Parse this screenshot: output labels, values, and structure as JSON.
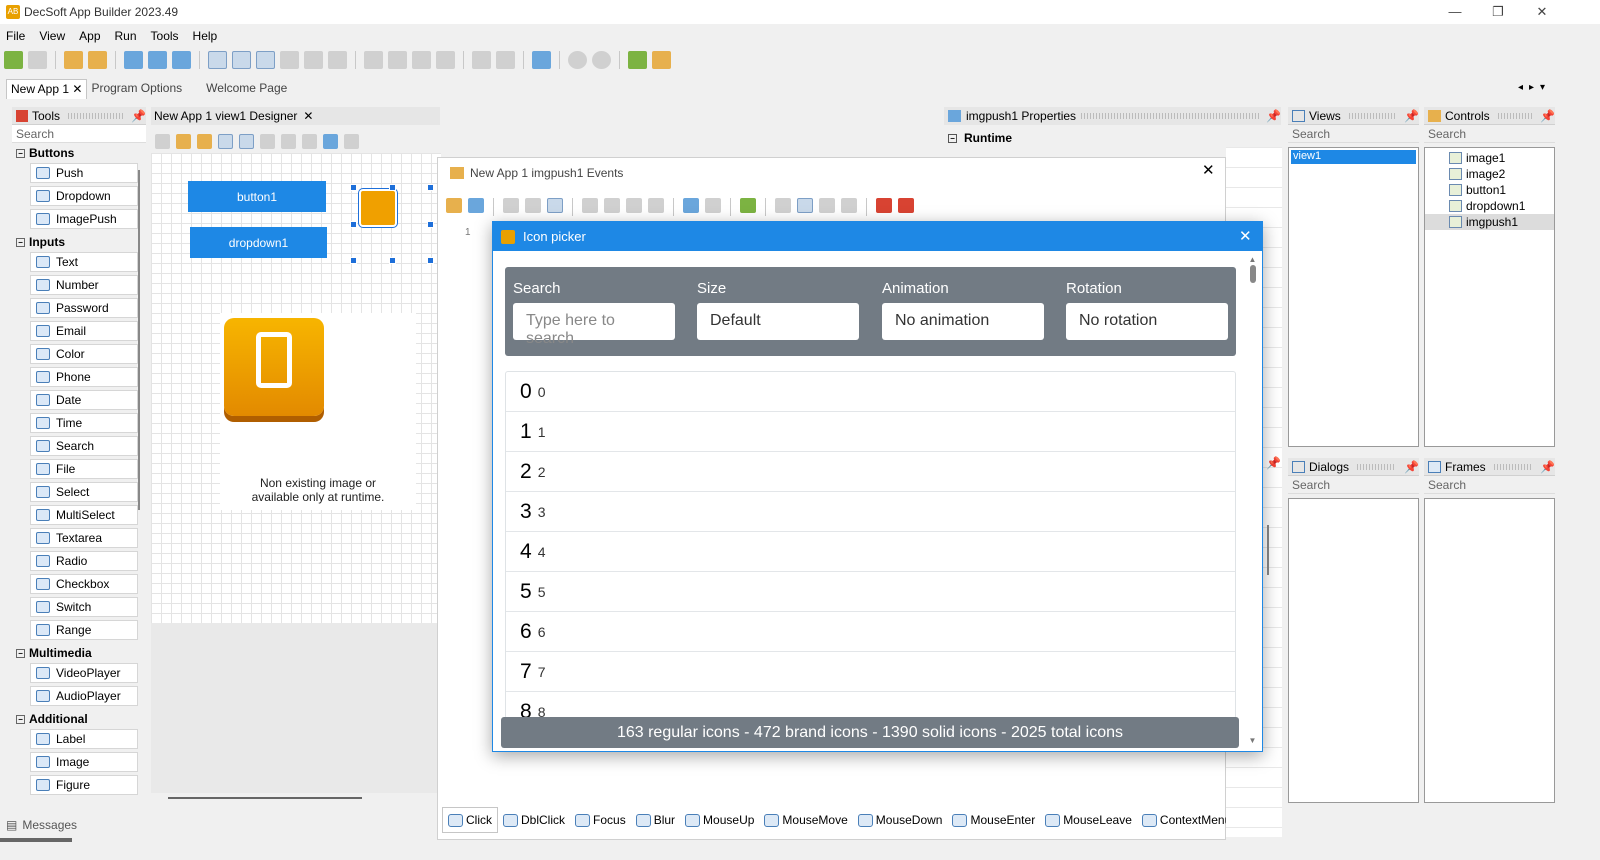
{
  "window": {
    "title": "DecSoft App Builder 2023.49",
    "app_icon": "AB"
  },
  "menu": [
    "File",
    "View",
    "App",
    "Run",
    "Tools",
    "Help"
  ],
  "doc_tabs": [
    "New App 1",
    "Program Options",
    "Welcome Page"
  ],
  "tools_panel": {
    "title": "Tools",
    "search": "Search",
    "groups": [
      {
        "name": "Buttons",
        "items": [
          "Push",
          "Dropdown",
          "ImagePush"
        ]
      },
      {
        "name": "Inputs",
        "items": [
          "Text",
          "Number",
          "Password",
          "Email",
          "Color",
          "Phone",
          "Date",
          "Time",
          "Search",
          "File",
          "Select",
          "MultiSelect",
          "Textarea",
          "Radio",
          "Checkbox",
          "Switch",
          "Range"
        ]
      },
      {
        "name": "Multimedia",
        "items": [
          "VideoPlayer",
          "AudioPlayer"
        ]
      },
      {
        "name": "Additional",
        "items": [
          "Label",
          "Image",
          "Figure"
        ]
      }
    ]
  },
  "messages_label": "Messages",
  "designer": {
    "tab_title": "New App 1 view1 Designer",
    "button1": "button1",
    "dropdown1": "dropdown1",
    "image_note_line1": "Non existing image or",
    "image_note_line2": "available only at runtime."
  },
  "events_window": {
    "title": "New App 1 imgpush1 Events",
    "line_number": "1",
    "tabs": [
      "Click",
      "DblClick",
      "Focus",
      "Blur",
      "MouseUp",
      "MouseMove",
      "MouseDown",
      "MouseEnter",
      "MouseLeave",
      "ContextMenu"
    ]
  },
  "properties_panel": {
    "title": "imgpush1 Properties",
    "section": "Runtime"
  },
  "views_panel": {
    "title": "Views",
    "search": "Search",
    "items": [
      "view1"
    ]
  },
  "controls_panel": {
    "title": "Controls",
    "search": "Search",
    "items": [
      "image1",
      "image2",
      "button1",
      "dropdown1",
      "imgpush1"
    ]
  },
  "dialogs_panel": {
    "title": "Dialogs",
    "search": "Search"
  },
  "frames_panel": {
    "title": "Frames",
    "search": "Search"
  },
  "icon_picker": {
    "title": "Icon picker",
    "filters": {
      "search_label": "Search",
      "search_placeholder": "Type here to search",
      "size_label": "Size",
      "size_value": "Default",
      "animation_label": "Animation",
      "animation_value": "No animation",
      "rotation_label": "Rotation",
      "rotation_value": "No rotation"
    },
    "rows": [
      {
        "glyph": "0",
        "name": "0"
      },
      {
        "glyph": "1",
        "name": "1"
      },
      {
        "glyph": "2",
        "name": "2"
      },
      {
        "glyph": "3",
        "name": "3"
      },
      {
        "glyph": "4",
        "name": "4"
      },
      {
        "glyph": "5",
        "name": "5"
      },
      {
        "glyph": "6",
        "name": "6"
      },
      {
        "glyph": "7",
        "name": "7"
      },
      {
        "glyph": "8",
        "name": "8"
      }
    ],
    "footer": "163 regular icons - 472 brand icons - 1390 solid icons - 2025 total icons"
  },
  "colors": {
    "accent": "#1e88e5",
    "filter_bg": "#727b84",
    "imagepush_orange": "#f0a000"
  }
}
